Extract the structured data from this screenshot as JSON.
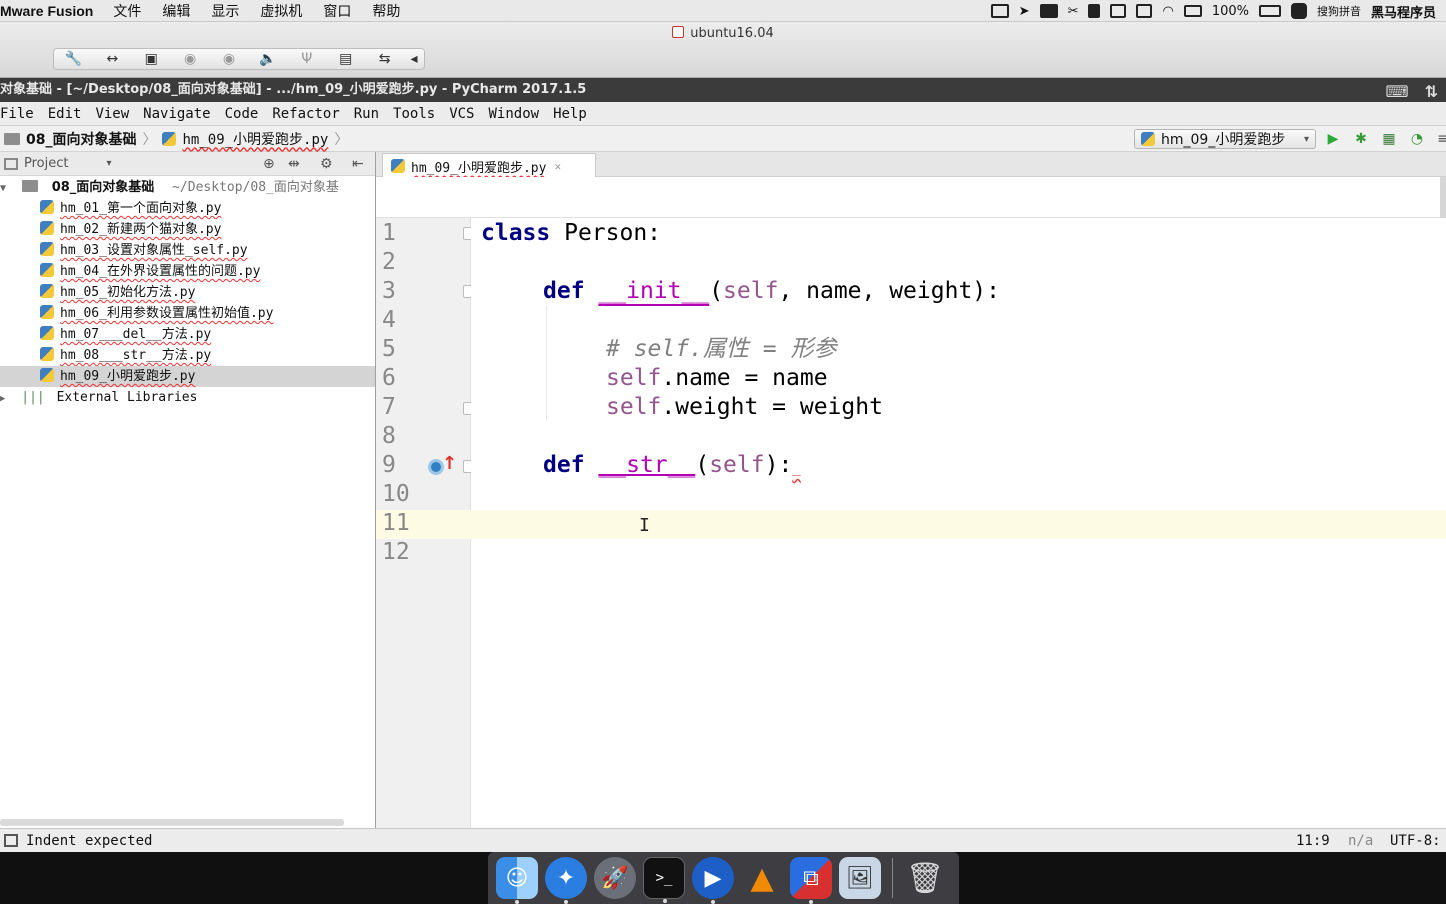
{
  "mac_menubar": {
    "app_name": "Mware Fusion",
    "menus": [
      "文件",
      "编辑",
      "显示",
      "虚拟机",
      "窗口",
      "帮助"
    ],
    "battery": "100%",
    "input_method": "搜狗拼音",
    "user": "黑马程序员"
  },
  "vmware": {
    "vm_name": "ubuntu16.04"
  },
  "pycharm_title": "对象基础 - [~/Desktop/08_面向对象基础] - .../hm_09_小明爱跑步.py - PyCharm 2017.1.5",
  "ide_menu": [
    "File",
    "Edit",
    "View",
    "Navigate",
    "Code",
    "Refactor",
    "Run",
    "Tools",
    "VCS",
    "Window",
    "Help"
  ],
  "navbar": {
    "crumb_project": "08_面向对象基础",
    "crumb_file": "hm_09_小明爱跑步.py",
    "run_config": "hm_09_小明爱跑步"
  },
  "project_panel": {
    "header": "Project",
    "root_name": "08_面向对象基础",
    "root_path": "~/Desktop/08_面向对象基",
    "files": [
      "hm_01_第一个面向对象.py",
      "hm_02_新建两个猫对象.py",
      "hm_03_设置对象属性_self.py",
      "hm_04_在外界设置属性的问题.py",
      "hm_05_初始化方法.py",
      "hm_06_利用参数设置属性初始值.py",
      "hm_07___del__方法.py",
      "hm_08___str__方法.py",
      "hm_09_小明爱跑步.py"
    ],
    "external_libraries": "External Libraries"
  },
  "editor": {
    "tab_label": "hm_09_小明爱跑步.py",
    "line_numbers": [
      "1",
      "2",
      "3",
      "4",
      "5",
      "6",
      "7",
      "8",
      "9",
      "10",
      "11",
      "12"
    ],
    "code": {
      "l1_kw": "class",
      "l1_rest": " Person:",
      "l3_kw": "def",
      "l3_fn": "__init__",
      "l3_open": "(",
      "l3_self": "self",
      "l3_rest": ", name, weight):",
      "l5_comment": "# self.属性 = 形参",
      "l6_self": "self",
      "l6_rest": ".name = name",
      "l7_self": "self",
      "l7_rest": ".weight = weight",
      "l9_kw": "def",
      "l9_fn": "__str__",
      "l9_open": "(",
      "l9_self": "self",
      "l9_rest": "):",
      "l9_err": "_"
    },
    "current_line": 11
  },
  "status_bar": {
    "message": "Indent expected",
    "position": "11:9",
    "na": "n/a",
    "encoding": "UTF-8:"
  }
}
